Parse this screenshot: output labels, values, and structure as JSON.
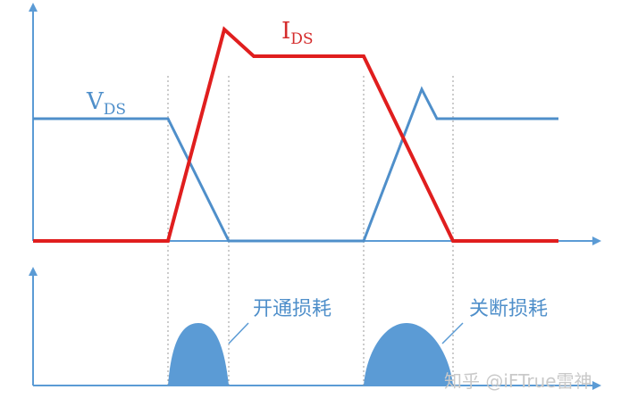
{
  "labels": {
    "vds_main": "V",
    "vds_sub": "DS",
    "ids_main": "I",
    "ids_sub": "DS",
    "turn_on_loss": "开通损耗",
    "turn_off_loss": "关断损耗"
  },
  "watermark": "知乎 @iFTrue雷神",
  "colors": {
    "vds": "#4f8fca",
    "ids": "#e01e1e",
    "axis": "#5b9bd5",
    "loss_fill": "#5b9bd5",
    "guide": "#9a9a9a"
  }
}
